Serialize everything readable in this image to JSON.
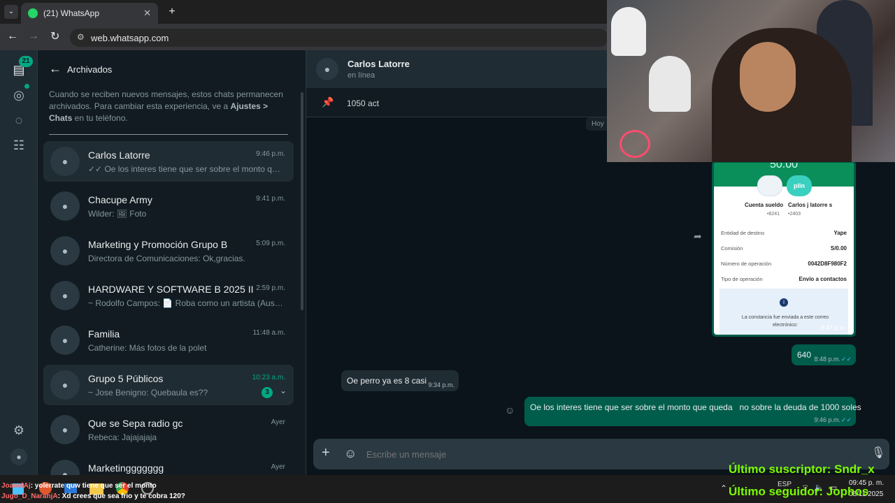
{
  "browser": {
    "tab_title": "(21) WhatsApp",
    "url": "web.whatsapp.com"
  },
  "rail": {
    "chats_badge": "21"
  },
  "archived": {
    "title": "Archivados",
    "info_prefix": "Cuando se reciben nuevos mensajes, estos chats permanecen archivados. Para cambiar esta experiencia, ve a ",
    "info_bold": "Ajustes > Chats",
    "info_suffix": " en tu teléfono.",
    "chats": [
      {
        "name": "Carlos Latorre",
        "time": "9:46 p.m.",
        "preview": "✓✓ Oe los interes tiene que ser sobre el monto que ..."
      },
      {
        "name": "Chacupe Army",
        "time": "9:41 p.m.",
        "preview": "Wilder: 🖼 Foto"
      },
      {
        "name": "Marketing y Promoción Grupo B",
        "time": "5:09 p.m.",
        "preview": "Directora de Comunicaciones: Ok,gracias."
      },
      {
        "name": "HARDWARE Y SOFTWARE B 2025 II",
        "time": "2:59 p.m.",
        "preview": "~ Rodolfo Campos: 📄 Roba como un artista (Austin ..."
      },
      {
        "name": "Familia",
        "time": "11:48 a.m.",
        "preview": "Catherine: Más fotos de la polet"
      },
      {
        "name": "Grupo 5 Públicos",
        "time": "10:23 a.m.",
        "preview": "~ Jose Benigno: Quebaula es??",
        "unread": "3"
      },
      {
        "name": "Que se Sepa radio gc",
        "time": "Ayer",
        "preview": "Rebeca: Jajajajaja"
      },
      {
        "name": "Marketinggggggg",
        "time": "Ayer",
        "preview": ""
      }
    ]
  },
  "chat": {
    "contact_name": "Carlos Latorre",
    "status": "en línea",
    "pinned_text": "1050 act",
    "date_chip": "Hoy",
    "receipt": {
      "amount": "50.00",
      "from_label": "Cuenta sueldo",
      "from_num": "•8241",
      "to_label": "Carlos j latorre s",
      "to_num": "•2403",
      "to_brand": "plin",
      "rows": [
        {
          "k": "Entidad de destino",
          "v": "Yape"
        },
        {
          "k": "Comisión",
          "v": "S/0.00"
        },
        {
          "k": "Número de operación",
          "v": "0042D8F980F2"
        },
        {
          "k": "Tipo de operación",
          "v": "Envío a contactos"
        }
      ],
      "note": "La constancia fue enviada a este correo electrónico:",
      "time": "8:47 p.m."
    },
    "messages": [
      {
        "dir": "out",
        "text": "640",
        "time": "8:48 p.m."
      },
      {
        "dir": "in",
        "text": "Oe perro ya es 8 casi",
        "time": "9:34 p.m."
      },
      {
        "dir": "out",
        "text": "Oe los interes tiene que ser sobre el monto que queda   no sobre la deuda de 1000 soles",
        "time": "9:46 p.m."
      }
    ],
    "composer_placeholder": "Escribe un mensaje"
  },
  "overlay": {
    "subscriber": "Último suscriptor: Sndr_x",
    "follower": "Último seguidor: Jophos",
    "chat_lines": [
      {
        "user": "JoaoelAj",
        "text": ": yolerrate quw tiene que ser el monto"
      },
      {
        "user": "Jugo_D_NaranjA",
        "text": ": Xd crees que sea frio y te cobra 120?"
      }
    ]
  },
  "taskbar": {
    "lang": "ESP",
    "time": "09:45 p. m.",
    "date": "05/11/2025"
  },
  "colors": {
    "accent": "#00a884",
    "bubble_out": "#005c4b",
    "bubble_in": "#202c33",
    "overlay_text": "#7CFC00"
  }
}
